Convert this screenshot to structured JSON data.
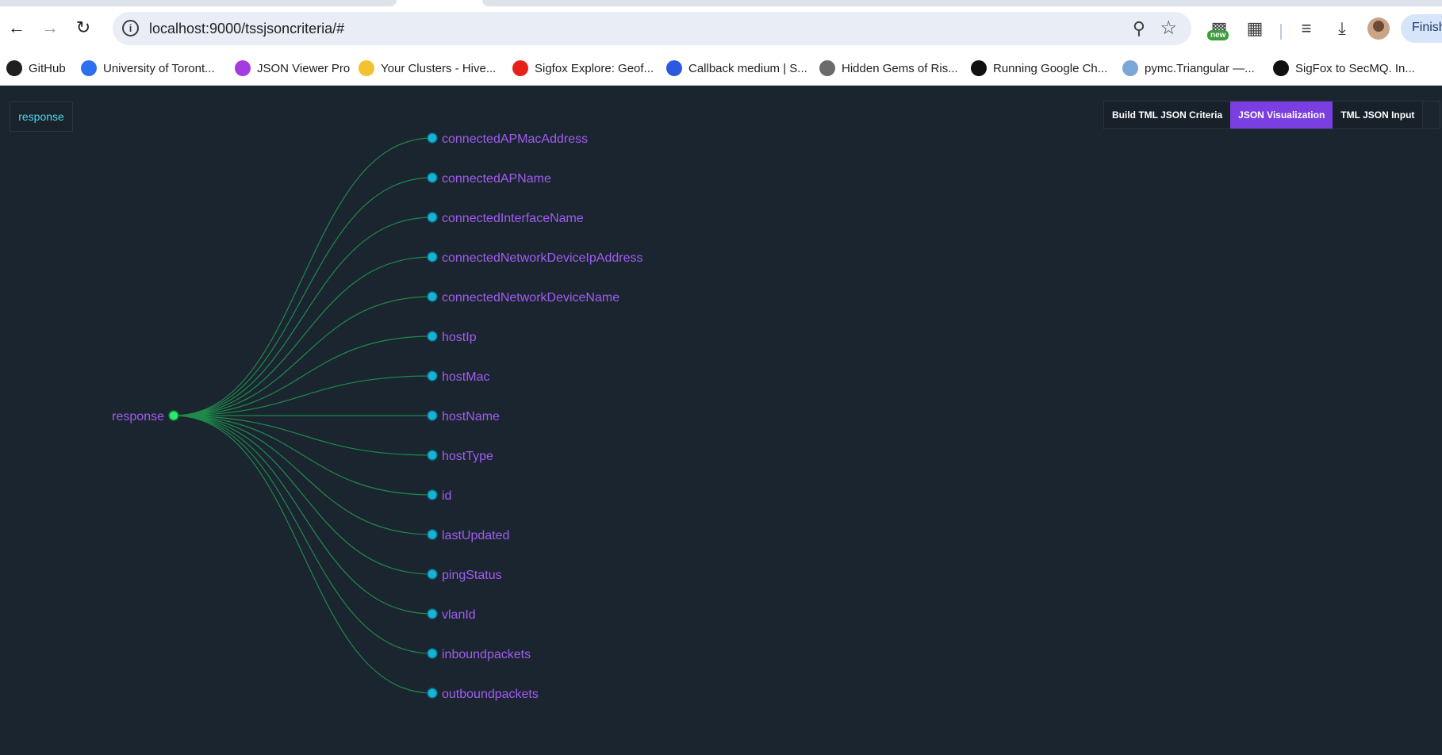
{
  "browser": {
    "url": "localhost:9000/tssjsoncriteria/#",
    "new_badge": "new",
    "profile_button": "Finish",
    "bookmarks": [
      {
        "label": "GitHub",
        "icon": "github-icon",
        "color": "#1f1f1f"
      },
      {
        "label": "University of Toront...",
        "icon": "zoom-icon",
        "color": "#2d6ff2"
      },
      {
        "label": "JSON Viewer Pro",
        "icon": "json-viewer-icon",
        "color": "#a33be0"
      },
      {
        "label": "Your Clusters - Hive...",
        "icon": "hivemq-icon",
        "color": "#f2c230"
      },
      {
        "label": "Sigfox Explore: Geof...",
        "icon": "youtube-icon",
        "color": "#e62117"
      },
      {
        "label": "Callback medium | S...",
        "icon": "butterfly-icon",
        "color": "#2b59e0"
      },
      {
        "label": "Hidden Gems of Ris...",
        "icon": "building-icon",
        "color": "#6b6b6b"
      },
      {
        "label": "Running Google Ch...",
        "icon": "medium-icon",
        "color": "#111111"
      },
      {
        "label": "pymc.Triangular —...",
        "icon": "rocket-icon",
        "color": "#7aa7d8"
      },
      {
        "label": "SigFox to SecMQ. In...",
        "icon": "medium-icon",
        "color": "#111111"
      }
    ]
  },
  "app": {
    "root_tag": "response",
    "tabs": [
      {
        "label": "Build TML JSON Criteria",
        "active": false
      },
      {
        "label": "JSON Visualization",
        "active": true
      },
      {
        "label": "TML JSON Input",
        "active": false
      }
    ],
    "tree": {
      "root": "response",
      "children": [
        "connectedAPMacAddress",
        "connectedAPName",
        "connectedInterfaceName",
        "connectedNetworkDeviceIpAddress",
        "connectedNetworkDeviceName",
        "hostIp",
        "hostMac",
        "hostName",
        "hostType",
        "id",
        "lastUpdated",
        "pingStatus",
        "vlanId",
        "inboundpackets",
        "outboundpackets"
      ],
      "colors": {
        "link": "#1e8a4a",
        "root_node": "#2ee86b",
        "leaf_node": "#16b3d6",
        "leaf_stroke": "#0b6f86",
        "label": "#a15cf0"
      }
    }
  }
}
